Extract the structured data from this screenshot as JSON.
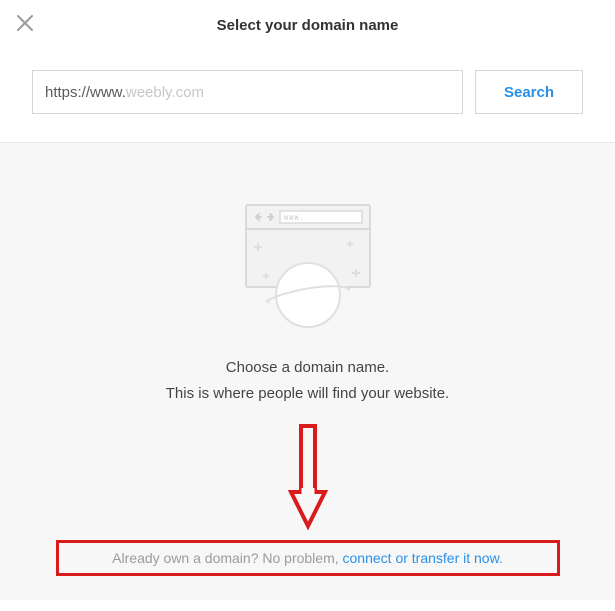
{
  "header": {
    "title": "Select your domain name",
    "close_icon": "close-icon"
  },
  "search": {
    "prefix": "https://www.",
    "placeholder": "weebly.com",
    "button_label": "Search"
  },
  "body": {
    "line1": "Choose a domain name.",
    "line2": "This is where people will find your website."
  },
  "footer": {
    "prompt_text": "Already own a domain? No problem, ",
    "link_text": "connect or transfer it now."
  }
}
